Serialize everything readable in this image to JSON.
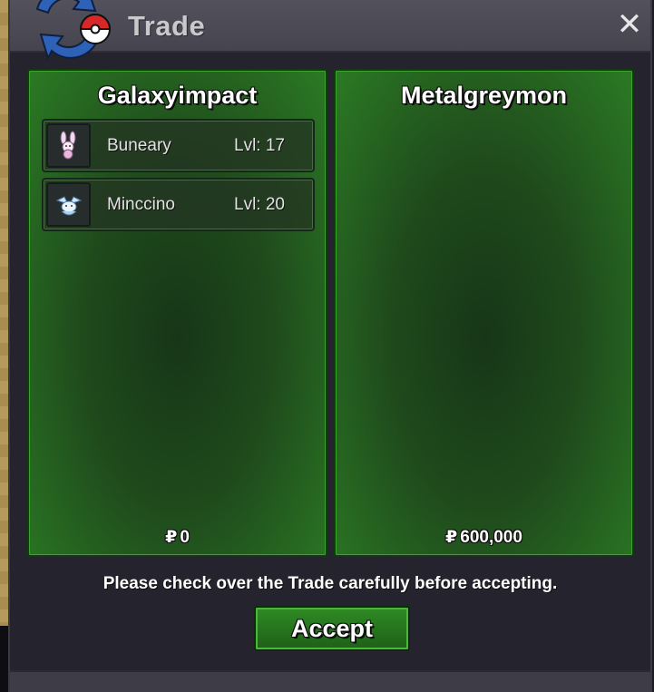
{
  "window": {
    "title": "Trade",
    "close_icon": "close-icon",
    "logo_icon": "trade-swap-pokeball-icon"
  },
  "left_panel": {
    "player": "Galaxyimpact",
    "pokemon": [
      {
        "icon": "buneary-sprite-icon",
        "name": "Buneary",
        "level": "Lvl: 17"
      },
      {
        "icon": "minccino-sprite-icon",
        "name": "Minccino",
        "level": "Lvl: 20"
      }
    ],
    "currency": "₽",
    "money": "0"
  },
  "right_panel": {
    "player": "Metalgreymon",
    "pokemon": [],
    "currency": "₽",
    "money": "600,000"
  },
  "notice": "Please check over the Trade carefully before accepting.",
  "accept_button": "Accept",
  "colors": {
    "panel_green": "#2b7a24",
    "accept_green": "#2f8b24",
    "titlebar": "#4a4954"
  }
}
